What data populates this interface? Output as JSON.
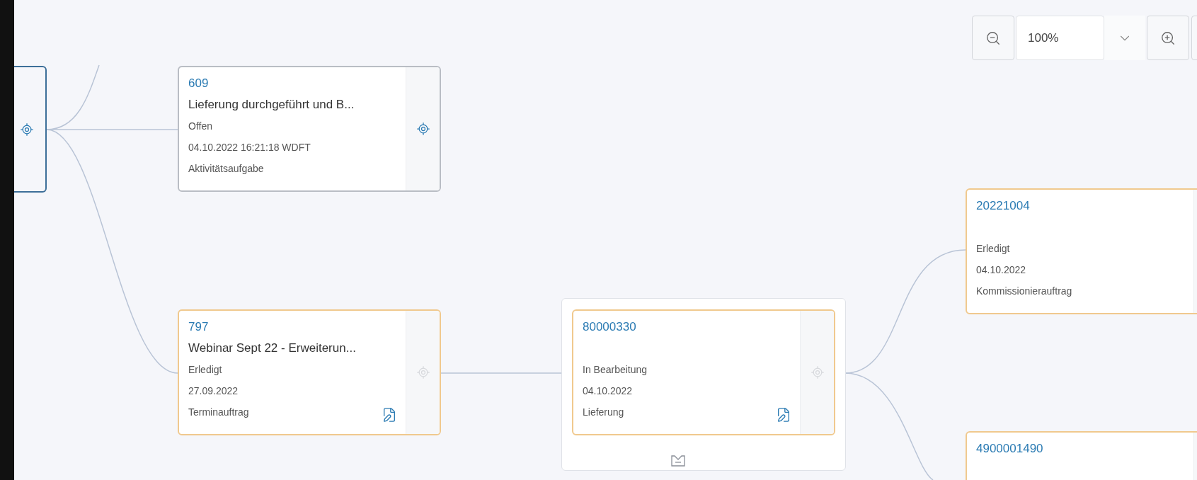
{
  "toolbar": {
    "zoom_value": "100%"
  },
  "root_node": {
    "focus_enabled": true
  },
  "nodes": [
    {
      "id": "609",
      "title": "Lieferung durchgeführt und B...",
      "status": "Offen",
      "date": "04.10.2022 16:21:18 WDFT",
      "type": "Aktivitätsaufgabe",
      "color": "#b9bdc4",
      "focus_enabled": true,
      "document_link": false,
      "grouped": false
    },
    {
      "id": "797",
      "title": "Webinar Sept 22 - Erweiterun...",
      "status": "Erledigt",
      "date": "27.09.2022",
      "type": "Terminauftrag",
      "color": "#f0c98e",
      "focus_enabled": false,
      "document_link": true,
      "grouped": false
    },
    {
      "id": "80000330",
      "status": "In Bearbeitung",
      "date": "04.10.2022",
      "type": "Lieferung",
      "color": "#f0c98e",
      "focus_enabled": false,
      "document_link": true,
      "grouped": true
    },
    {
      "id": "20221004",
      "status": "Erledigt",
      "date": "04.10.2022",
      "type": "Kommissionierauftrag",
      "color": "#f0c98e",
      "document_link": false,
      "grouped": false
    },
    {
      "id": "4900001490",
      "color": "#f0c98e",
      "document_link": false,
      "grouped": false
    }
  ]
}
